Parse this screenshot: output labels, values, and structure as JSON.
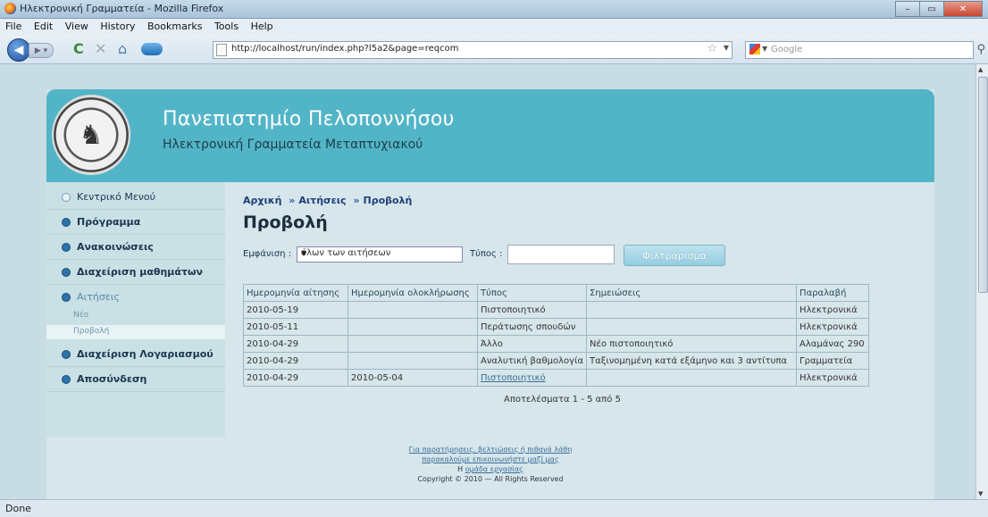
{
  "window": {
    "title": "Ηλεκτρονική Γραμματεία - Mozilla Firefox",
    "buttons": {
      "min": "–",
      "max": "▭",
      "close": "✕"
    }
  },
  "menu": [
    "File",
    "Edit",
    "View",
    "History",
    "Bookmarks",
    "Tools",
    "Help"
  ],
  "nav": {
    "url": "http://localhost/run/index.php?l5a2&page=reqcom",
    "search_placeholder": "Google"
  },
  "site": {
    "title": "Πανεπιστημίο Πελοποννήσου",
    "subtitle": "Ηλεκτρονική Γραμματεία Μεταπτυχιακού"
  },
  "sidebar": {
    "items": [
      {
        "label": "Κεντρικό Μενού"
      },
      {
        "label": "Πρόγραμμα"
      },
      {
        "label": "Ανακοινώσεις"
      },
      {
        "label": "Διαχείριση μαθημάτων"
      },
      {
        "label": "Αιτήσεις"
      },
      {
        "label": "Διαχείριση Λογαριασμού"
      },
      {
        "label": "Αποσύνδεση"
      }
    ],
    "subitems": [
      {
        "label": "Νέο"
      },
      {
        "label": "Προβολή"
      }
    ]
  },
  "main": {
    "breadcrumb": [
      "Αρχική",
      "Αιτήσεις",
      "Προβολή"
    ],
    "breadcrumb_sep": "»",
    "page_title": "Προβολή",
    "filter": {
      "show_label": "Εμφάνιση :",
      "show_value": "όλων των αιτήσεων",
      "type_label": "Τύπος :",
      "type_value": "",
      "button": "Φιλτράρισμα"
    },
    "table": {
      "headers": [
        "Ημερομηνία αίτησης",
        "Ημερομηνία ολοκλήρωσης",
        "Τύπος",
        "Σημειώσεις",
        "Παραλαβή"
      ],
      "rows": [
        [
          "2010-05-19",
          "",
          "Πιστοποιητικό",
          "",
          "Ηλεκτρονικά"
        ],
        [
          "2010-05-11",
          "",
          "Περάτωσης σπουδών",
          "",
          "Ηλεκτρονικά"
        ],
        [
          "2010-04-29",
          "",
          "Άλλο",
          "Νέο πιστοποιητικό",
          "Αλαμάνας 290"
        ],
        [
          "2010-04-29",
          "",
          "Αναλυτική βαθμολογία",
          "Ταξινομημένη κατά εξάμηνο και 3 αντίτυπα",
          "Γραμματεία"
        ],
        [
          "2010-04-29",
          "2010-05-04",
          "Πιστοποιητικό",
          "",
          "Ηλεκτρονικά"
        ]
      ]
    },
    "results": "Αποτελέσματα 1 - 5 από 5"
  },
  "footer": {
    "line1": "Για παρατήρησεις, βελτιώσεις ή πιθανά λάθη",
    "line2": "παρακαλούμε επικοινωνήστε μαζί μας",
    "line3_prefix": "Η",
    "line3_link": "ομάδα εργασίας",
    "copyright": "Copyright © 2010 — All Rights Reserved"
  },
  "status": "Done"
}
